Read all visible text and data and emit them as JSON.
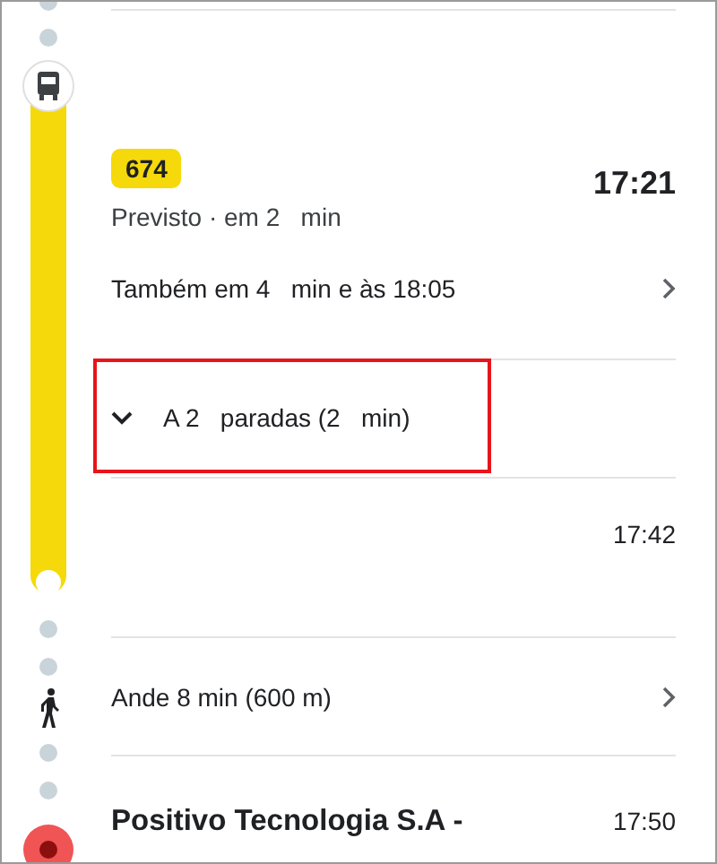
{
  "route": {
    "badge": "674",
    "status": "Previsto · em 2   min",
    "departure": "17:21",
    "also": "Também em 4   min e às 18:05",
    "stops": {
      "label": "A 2   paradas (2   min)",
      "expanded": false,
      "highlighted": true
    },
    "arrival": "17:42"
  },
  "walk": {
    "label": "Ande 8 min (600 m)"
  },
  "destination": {
    "name": "Positivo Tecnologia S.A -",
    "time": "17:50"
  }
}
